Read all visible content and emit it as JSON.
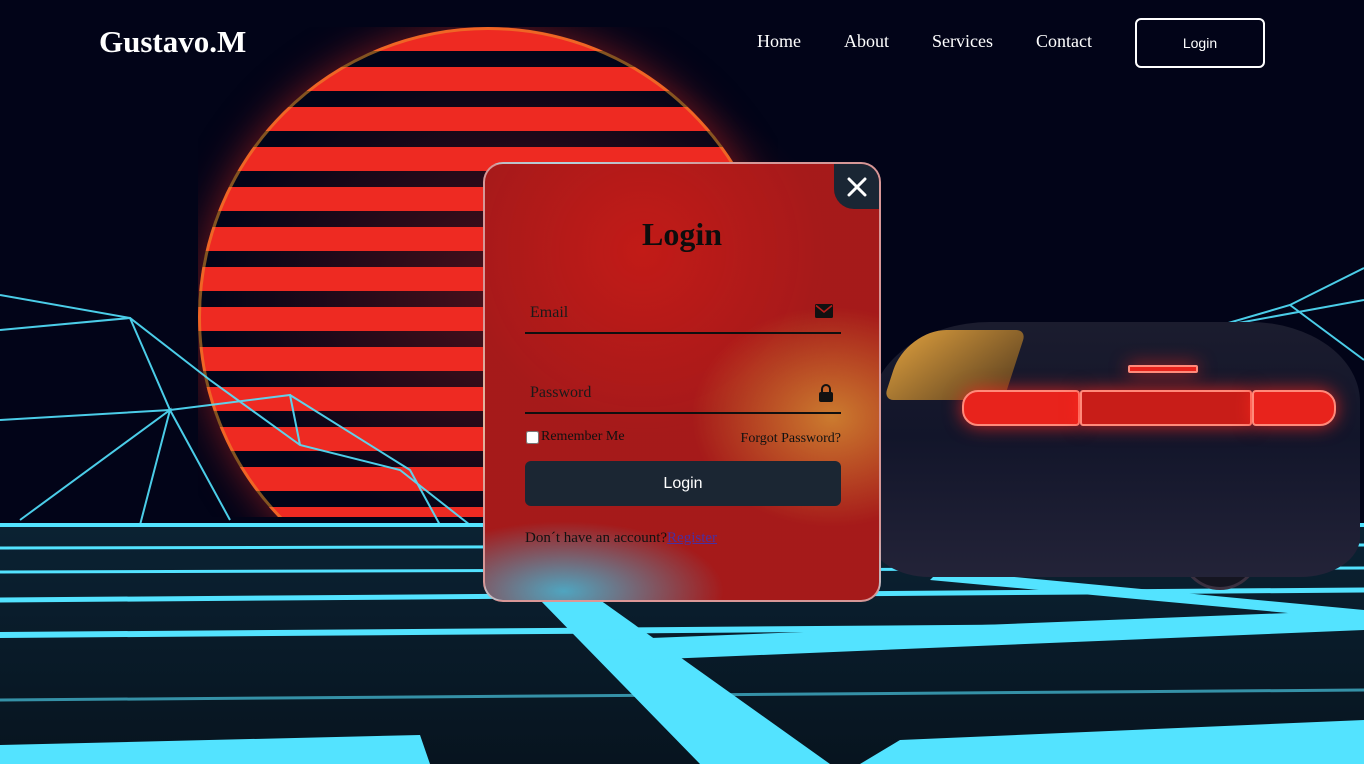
{
  "header": {
    "brand": "Gustavo.M",
    "nav": [
      "Home",
      "About",
      "Services",
      "Contact"
    ],
    "login_label": "Login"
  },
  "modal": {
    "title": "Login",
    "email_placeholder": "Email",
    "password_placeholder": "Password",
    "remember_label": "Remember Me",
    "forgot_label": "Forgot Password?",
    "submit_label": "Login",
    "no_account_text": "Don´t have an account?",
    "register_label": "Register",
    "icons": {
      "close": "close-icon",
      "email": "mail-icon",
      "password": "lock-icon"
    }
  },
  "colors": {
    "background": "#020418",
    "accent_cyan": "#53e3ff",
    "sun_red": "#ee2a22",
    "button_dark": "#1b2633"
  }
}
